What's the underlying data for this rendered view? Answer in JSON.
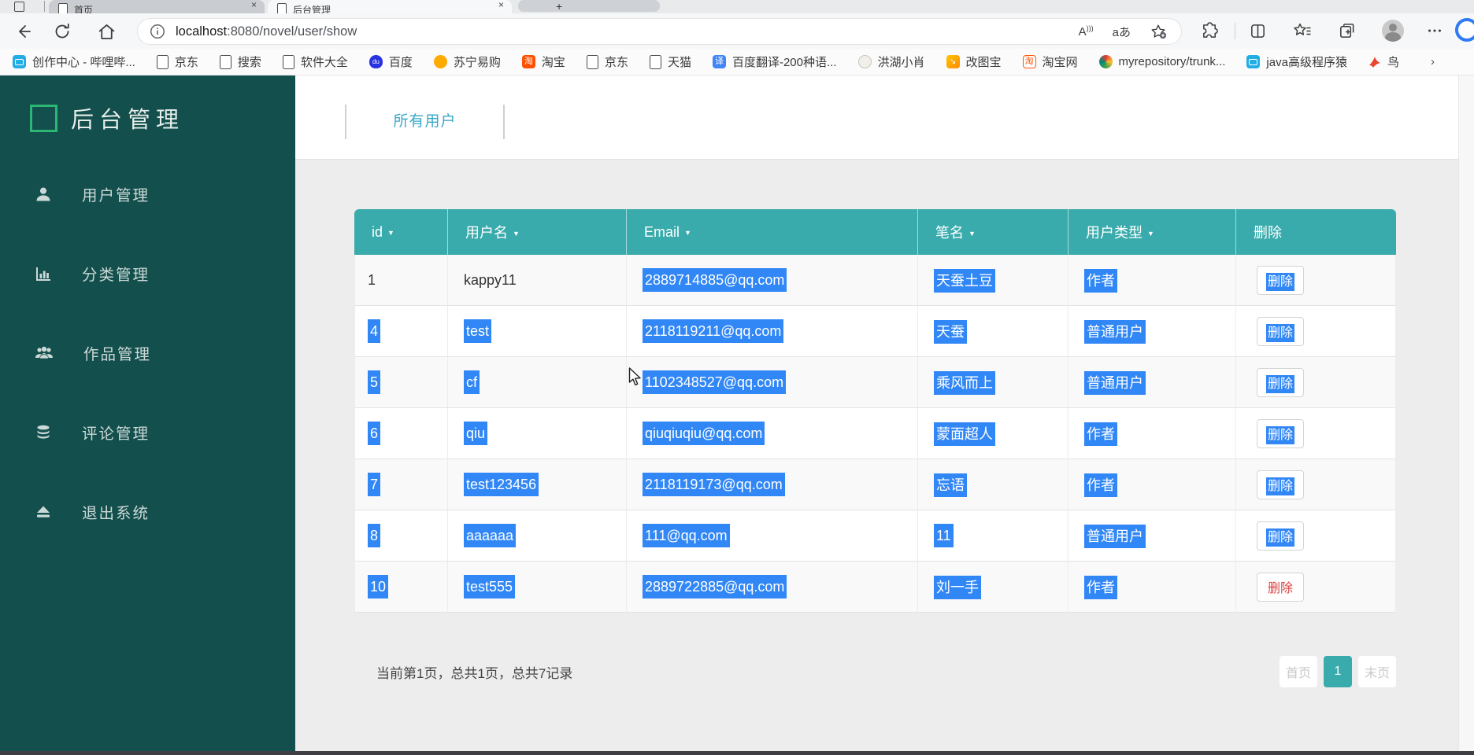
{
  "colors": {
    "sidebar_bg": "#134F4D",
    "table_header_teal": "#3AABAC",
    "selection_blue": "#3187F5",
    "link_teal": "#3AA9C9",
    "logo_green": "#2BB673",
    "delete_red": "#E03E3E",
    "page_bg": "#EDEDED"
  },
  "browser": {
    "tabs": [
      {
        "title": "首页",
        "active": false
      },
      {
        "title": "后台管理",
        "active": true
      }
    ],
    "glyphs": {
      "close": "×",
      "new_tab": "+",
      "overflow_chevron": "›",
      "more": "…",
      "read_aloud": "A",
      "translate": "aあ"
    },
    "url": {
      "host": "localhost",
      "rest": ":8080/novel/user/show"
    },
    "bookmarks": [
      {
        "label": "创作中心 - 哔哩哔...",
        "icon": "bilibili-icon"
      },
      {
        "label": "京东",
        "icon": "page-icon"
      },
      {
        "label": "搜索",
        "icon": "page-icon"
      },
      {
        "label": "软件大全",
        "icon": "page-icon"
      },
      {
        "label": "百度",
        "icon": "baidu-icon",
        "icon_text": "du"
      },
      {
        "label": "苏宁易购",
        "icon": "suning-icon"
      },
      {
        "label": "淘宝",
        "icon": "taobao-icon",
        "icon_text": "淘"
      },
      {
        "label": "京东",
        "icon": "page-icon"
      },
      {
        "label": "天猫",
        "icon": "page-icon"
      },
      {
        "label": "百度翻译-200种语...",
        "icon": "translate-icon",
        "icon_text": "译"
      },
      {
        "label": "洪湖小肖",
        "icon": "gray-bird-icon"
      },
      {
        "label": "改图宝",
        "icon": "gaitubao-icon",
        "icon_text": "↘"
      },
      {
        "label": "淘宝网",
        "icon": "taobao-outline-icon",
        "icon_text": "淘"
      },
      {
        "label": "myrepository/trunk...",
        "icon": "repo-icon"
      },
      {
        "label": "java高级程序猿",
        "icon": "bilibili-icon"
      },
      {
        "label": "鸟",
        "icon": "red-bird-icon"
      }
    ]
  },
  "sidebar": {
    "title": "后台管理",
    "items": [
      {
        "label": "用户管理",
        "icon": "user-icon"
      },
      {
        "label": "分类管理",
        "icon": "bar-chart-icon"
      },
      {
        "label": "作品管理",
        "icon": "users-icon"
      },
      {
        "label": "评论管理",
        "icon": "database-icon"
      },
      {
        "label": "退出系统",
        "icon": "eject-icon"
      }
    ]
  },
  "main": {
    "tab_label": "所有用户",
    "table": {
      "sort_caret": "▼",
      "delete_label": "删除",
      "headers": [
        {
          "label": "id",
          "sortable": true
        },
        {
          "label": "用户名",
          "sortable": true
        },
        {
          "label": "Email",
          "sortable": true
        },
        {
          "label": "笔名",
          "sortable": true
        },
        {
          "label": "用户类型",
          "sortable": true
        },
        {
          "label": "删除",
          "sortable": false
        }
      ],
      "rows": [
        {
          "id": "1",
          "username": "kappy11",
          "email": "2889714885@qq.com",
          "pen_name": "天蚕土豆",
          "user_type": "作者"
        },
        {
          "id": "4",
          "username": "test",
          "email": "2118119211@qq.com",
          "pen_name": "天蚕",
          "user_type": "普通用户"
        },
        {
          "id": "5",
          "username": "cf",
          "email": "1102348527@qq.com",
          "pen_name": "乘风而上",
          "user_type": "普通用户"
        },
        {
          "id": "6",
          "username": "qiu",
          "email": "qiuqiuqiu@qq.com",
          "pen_name": "蒙面超人",
          "user_type": "作者"
        },
        {
          "id": "7",
          "username": "test123456",
          "email": "2118119173@qq.com",
          "pen_name": "忘语",
          "user_type": "作者"
        },
        {
          "id": "8",
          "username": "aaaaaa",
          "email": "111@qq.com",
          "pen_name": "11",
          "user_type": "普通用户"
        },
        {
          "id": "10",
          "username": "test555",
          "email": "2889722885@qq.com",
          "pen_name": "刘一手",
          "user_type": "作者"
        }
      ]
    },
    "pagination": {
      "summary": "当前第1页，总共1页，总共7记录",
      "first_label": "首页",
      "current_page": "1",
      "last_label": "末页"
    }
  }
}
